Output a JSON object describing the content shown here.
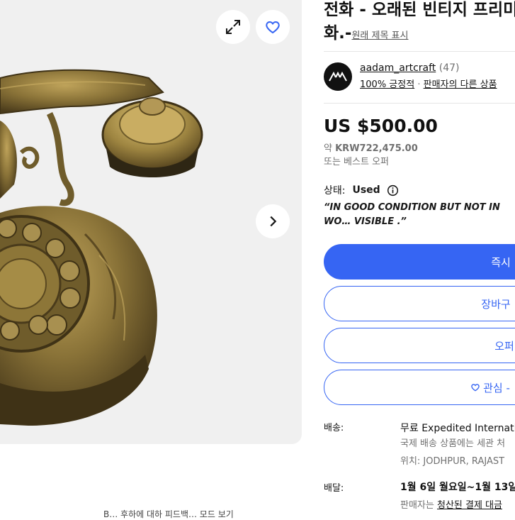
{
  "listing": {
    "title_line1": "전화 - 오래된 빈티지 프리미",
    "title_line2": "화.-",
    "original_title_link": "원래 제목 표시"
  },
  "seller": {
    "name": "aadam_artcraft",
    "count": "(47)",
    "feedback": "100% 긍정적",
    "separator": "·",
    "other_items": "판매자의 다른 상품"
  },
  "price": {
    "main": "US $500.00",
    "approx_prefix": "약",
    "approx_value": "KRW722,475.00",
    "best_offer": "또는 베스트 오퍼"
  },
  "condition": {
    "label": "상태:",
    "value": "Used",
    "description": "“IN GOOD CONDITION BUT NOT IN WO… VISIBLE .”"
  },
  "buttons": {
    "buy_now": "즉시",
    "add_to_cart": "장바구",
    "make_offer": "오퍼",
    "watch": "관심 -"
  },
  "shipping": {
    "label": "배송:",
    "main": "무료 Expedited Internatio",
    "note": "국제 배송 상품에는 세관 처",
    "location": "위치: JODHPUR, RAJAST"
  },
  "delivery": {
    "label": "배달:",
    "main": "1월 6일 월요일~1월 13일 월",
    "seller_prefix": "판매자는",
    "seller_link": "청산된 결제 대금"
  },
  "gallery": {
    "below_caption": "B… 후하에 대하 피드백… 모드 보기"
  },
  "icons": {
    "expand": "expand-icon",
    "favorite": "heart-icon",
    "next": "chevron-right-icon",
    "info": "info-icon"
  },
  "colors": {
    "primary": "#3665f3",
    "muted": "#707070",
    "gallery_bg": "#f0f0f0"
  }
}
